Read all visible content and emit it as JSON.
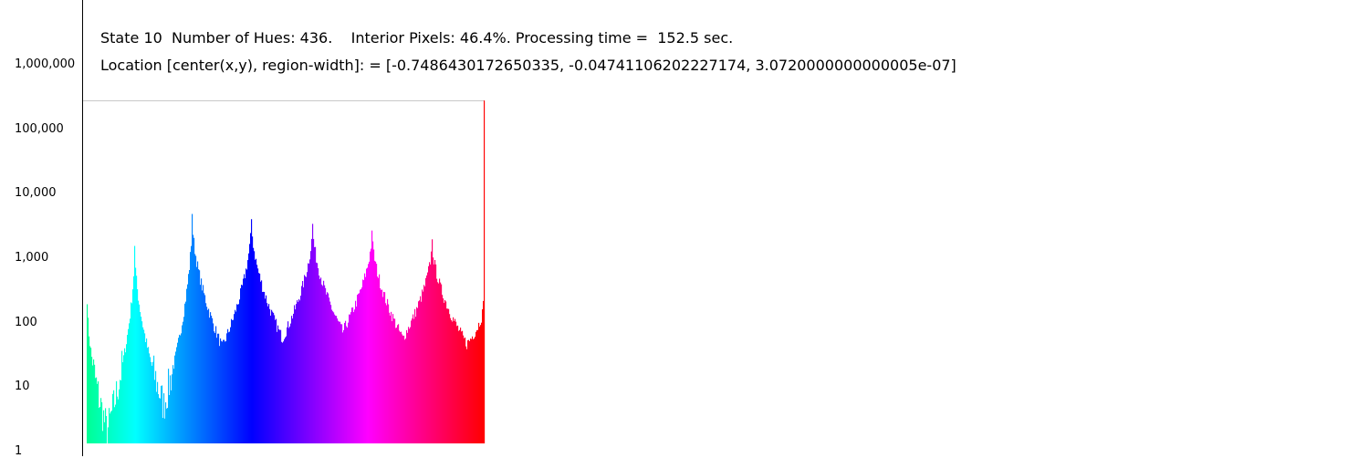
{
  "header": {
    "status_line": "State 10  Number of Hues: 436.    Interior Pixels: 46.4%. Processing time =  152.5 sec.",
    "location_line": "Location [center(x,y), region-width]: = [-0.7486430172650335, -0.04741106202227174, 3.0720000000000005e-07]"
  },
  "chart_data": {
    "type": "bar",
    "title": "",
    "xlabel": "",
    "ylabel": "",
    "y_scale": "log",
    "ylim": [
      1,
      1000000
    ],
    "y_ticks": [
      {
        "value": 1000000,
        "label": "1,000,000"
      },
      {
        "value": 100000,
        "label": "100,000"
      },
      {
        "value": 10000,
        "label": "10,000"
      },
      {
        "value": 1000,
        "label": "1,000"
      },
      {
        "value": 100,
        "label": "100"
      },
      {
        "value": 10,
        "label": "10"
      },
      {
        "value": 1,
        "label": "1"
      }
    ],
    "grid": false,
    "reference_line_value": 270000,
    "bin_count": 436,
    "hue_range_degrees": [
      155,
      360
    ],
    "bar_color_scheme": "hue gradient cyan-green to blue to magenta to red",
    "peaks": [
      {
        "bin": 52,
        "value": 1500
      },
      {
        "bin": 115,
        "value": 4700
      },
      {
        "bin": 180,
        "value": 3900
      },
      {
        "bin": 247,
        "value": 3300
      },
      {
        "bin": 312,
        "value": 2600
      },
      {
        "bin": 378,
        "value": 1900
      },
      {
        "bin": 435,
        "value": 270000
      }
    ],
    "valleys": [
      {
        "bin": 0,
        "value": 230
      },
      {
        "bin": 22,
        "value": 2
      },
      {
        "bin": 84,
        "value": 5
      },
      {
        "bin": 148,
        "value": 40
      },
      {
        "bin": 214,
        "value": 55
      },
      {
        "bin": 280,
        "value": 70
      },
      {
        "bin": 346,
        "value": 55
      },
      {
        "bin": 416,
        "value": 45
      },
      {
        "bin": 434,
        "value": 180
      }
    ]
  }
}
